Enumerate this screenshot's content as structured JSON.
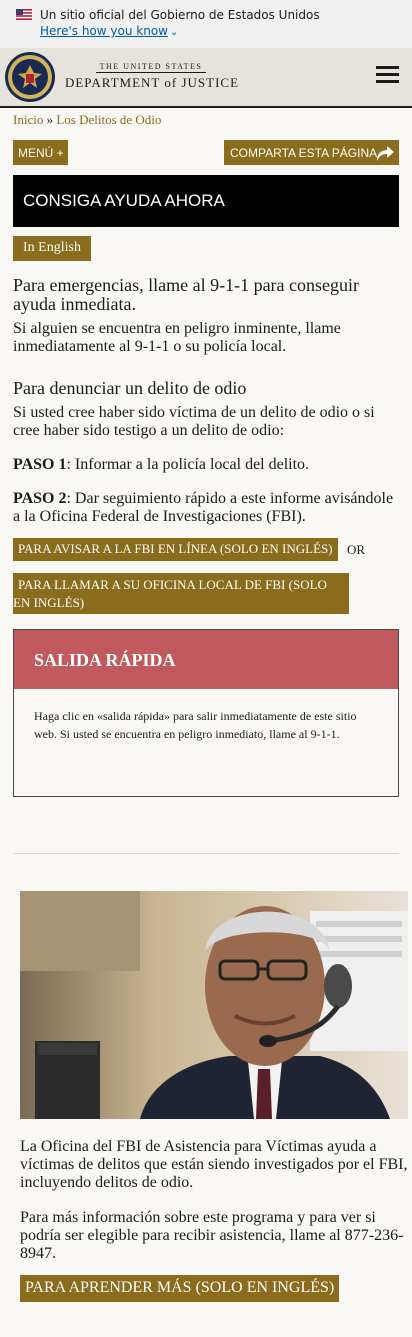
{
  "gov_banner": {
    "official_text": "Un sitio oficial del Gobierno de Estados Unidos",
    "how_link": "Here's how you know"
  },
  "header": {
    "wordmark_top": "THE UNITED STATES",
    "wordmark_bottom": "DEPARTMENT of JUSTICE"
  },
  "breadcrumb": {
    "home": "Inicio",
    "separator": "»",
    "current": "Los Delitos de Odio"
  },
  "buttons": {
    "menu": "MENÚ +",
    "share": "COMPARTA ESTA PÁGINA"
  },
  "help_box": {
    "title": "CONSIGA AYUDA AHORA"
  },
  "language_button": "In English",
  "emergency": {
    "heading": "Para emergencias, llame al 9-1-1 para conseguir ayuda inmediata.",
    "text": "Si alguien se encuentra en peligro inminente, llame inmediatamente al 9-1-1 o su policía local."
  },
  "report": {
    "heading": "Para denunciar un delito de odio",
    "intro": "Si usted cree haber sido víctima de un delito de odio o si cree haber sido testigo a un delito de odio:",
    "step1_label": "PASO 1",
    "step1_text": ": Informar a la policía local del delito.",
    "step2_label": "PASO 2",
    "step2_text": ": Dar seguimiento rápido a este informe avisándole a la Oficina Federal de Investigaciones (FBI).",
    "fbi_online": "PARA AVISAR A LA FBI EN LÍNEA (SOLO EN INGLÉS)",
    "or": "OR",
    "fbi_local": "PARA LLAMAR A SU OFICINA LOCAL DE FBI (SOLO EN INGLÉS)"
  },
  "quick_exit": {
    "title": "SALIDA RÁPIDA",
    "text": "Haga clic en «salida rápida» para salir inmediatamente de este sitio web. Si usted se encuentra en peligro inmediato, llame al 9-1-1."
  },
  "victim_office": {
    "text1": "La Oficina del FBI de Asistencia para Víctimas ayuda a víctimas de delitos que están siendo investigados por el FBI, incluyendo delitos de odio.",
    "text2": "Para más información sobre este programa y para ver si podría ser elegible para recibir asistencia, llame al 877-236-8947.",
    "learn_more": "PARA APRENDER MÁS (SOLO EN INGLÉS)"
  },
  "colors": {
    "gold": "#8b6b1c",
    "exit_red": "#c05a5e",
    "link_blue": "#005ea2"
  }
}
